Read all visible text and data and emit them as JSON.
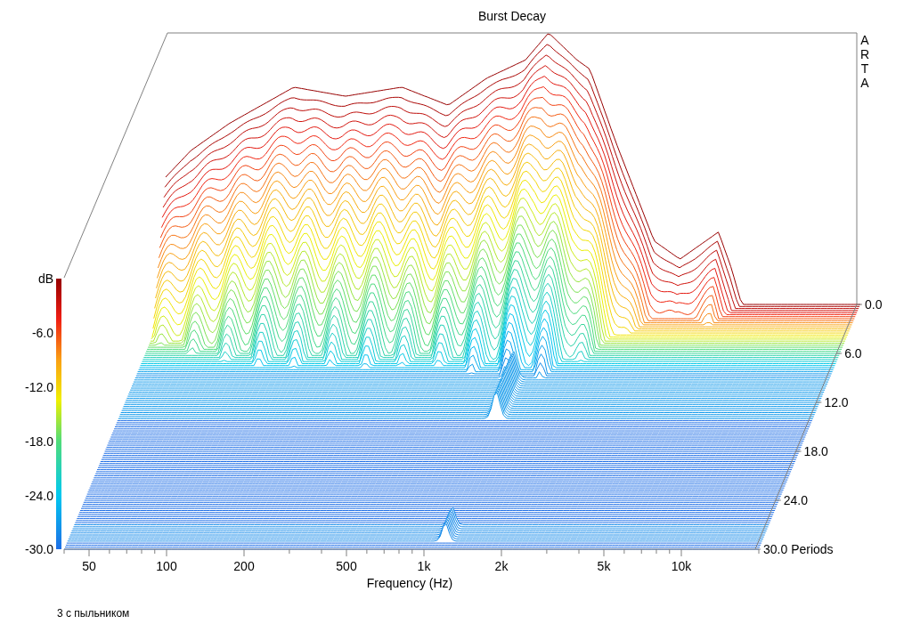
{
  "title": "Burst Decay",
  "logo": "ARTA",
  "level_scale": {
    "unit": "dB",
    "ticks": [
      "-6.0",
      "-12.0",
      "-18.0",
      "-24.0",
      "-30.0"
    ]
  },
  "frequency_axis": {
    "label": "Frequency (Hz)",
    "ticks": [
      "50",
      "100",
      "200",
      "500",
      "1k",
      "2k",
      "5k",
      "10k"
    ]
  },
  "period_axis": {
    "ticks": [
      "0.0",
      "6.0",
      "12.0",
      "18.0",
      "24.0",
      "30.0 Periods"
    ]
  },
  "caption": "3 с пыльником"
}
